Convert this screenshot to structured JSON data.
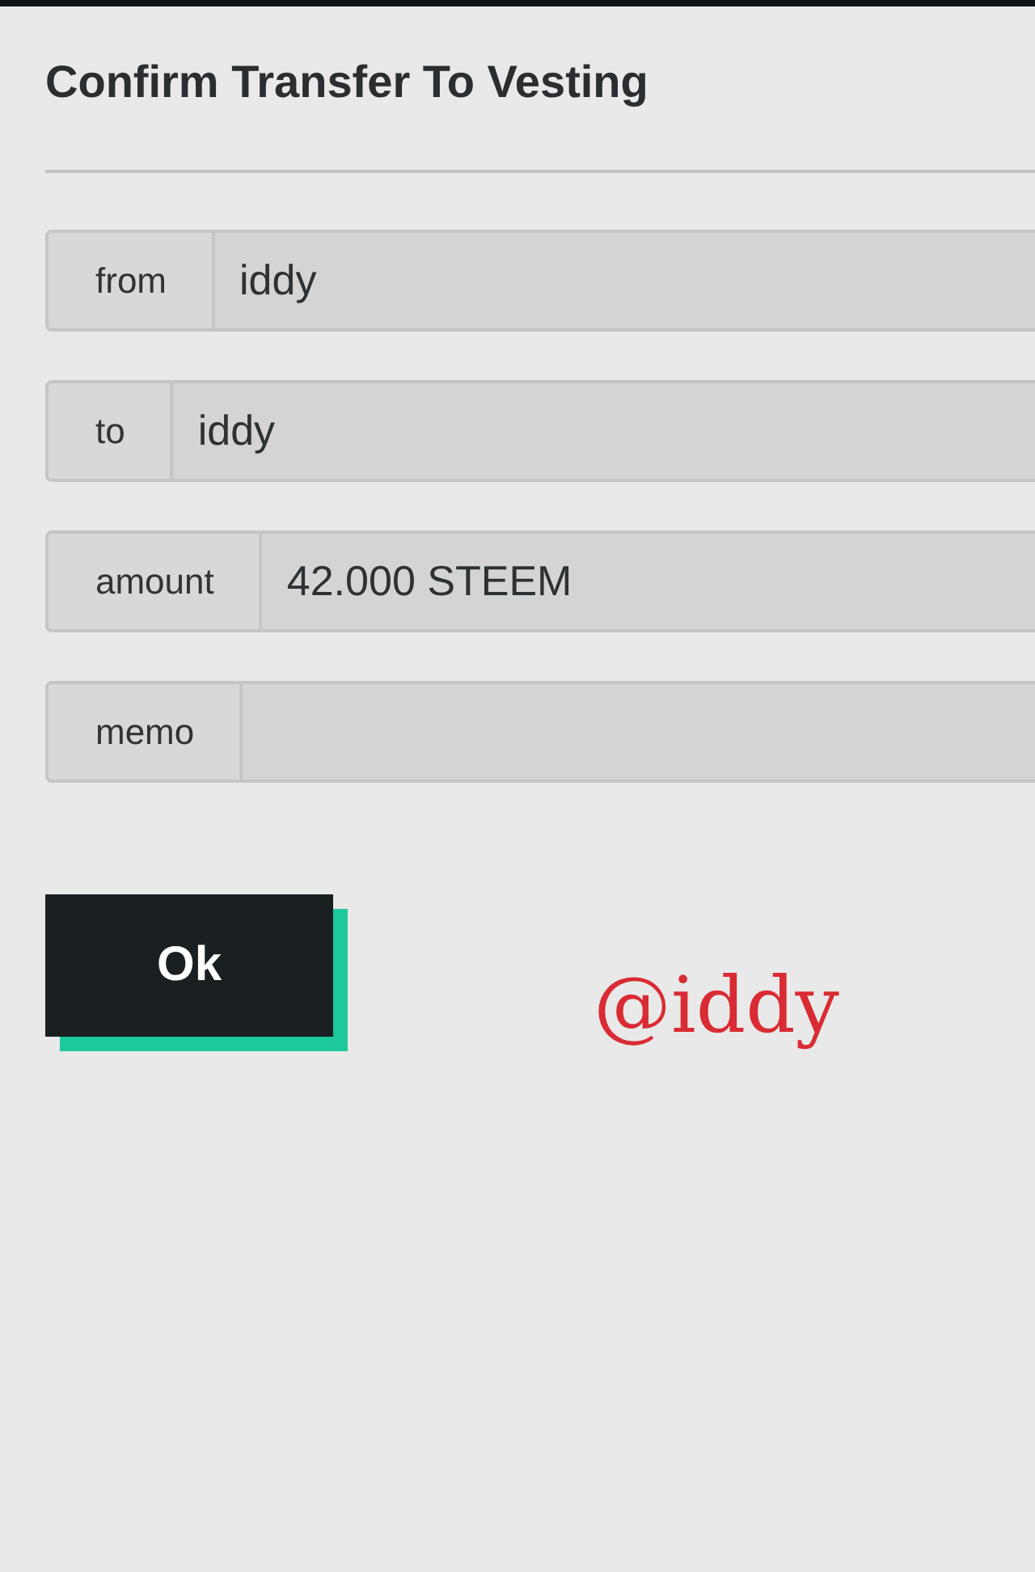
{
  "dialog": {
    "title": "Confirm Transfer To Vesting"
  },
  "fields": [
    {
      "label": "from",
      "value": "iddy"
    },
    {
      "label": "to",
      "value": "iddy"
    },
    {
      "label": "amount",
      "value": "42.000 STEEM"
    },
    {
      "label": "memo"
    }
  ],
  "buttons": [
    "Ok"
  ],
  "signature": "@iddy"
}
